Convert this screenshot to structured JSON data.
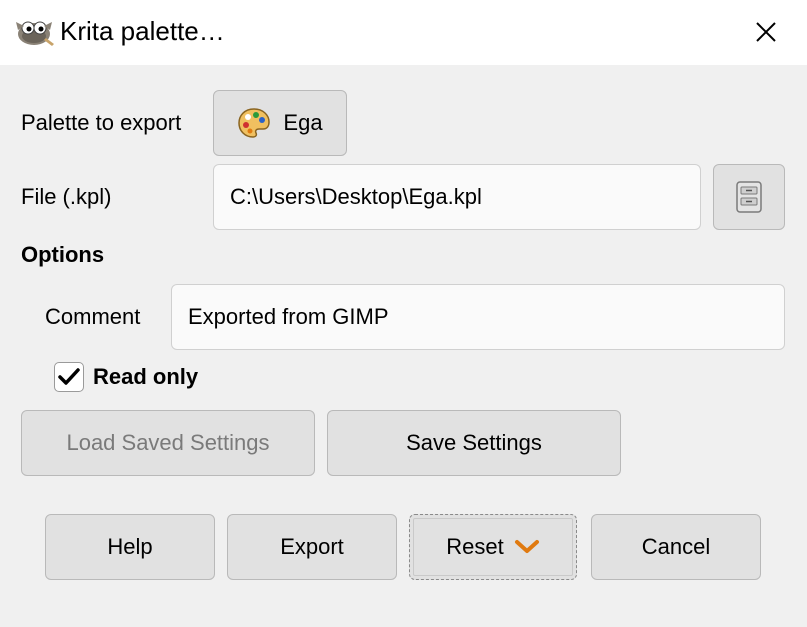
{
  "window": {
    "title": "Krita palette…"
  },
  "form": {
    "palette_label": "Palette to export",
    "palette_value": "Ega",
    "file_label": "File (.kpl)",
    "file_value": "C:\\Users\\Desktop\\Ega.kpl",
    "options_heading": "Options",
    "comment_label": "Comment",
    "comment_value": "Exported from GIMP",
    "readonly_label": "Read only",
    "readonly_checked": true
  },
  "settings": {
    "load_label": "Load Saved Settings",
    "save_label": "Save Settings"
  },
  "actions": {
    "help": "Help",
    "export": "Export",
    "reset": "Reset",
    "cancel": "Cancel"
  },
  "colors": {
    "accent": "#e07a10",
    "button_bg": "#e1e1e1",
    "dialog_bg": "#f0f0f0"
  },
  "icons": [
    "gimp-wilber-icon",
    "close-icon",
    "palette-icon",
    "file-chooser-icon",
    "check-icon",
    "chevron-down-icon"
  ]
}
